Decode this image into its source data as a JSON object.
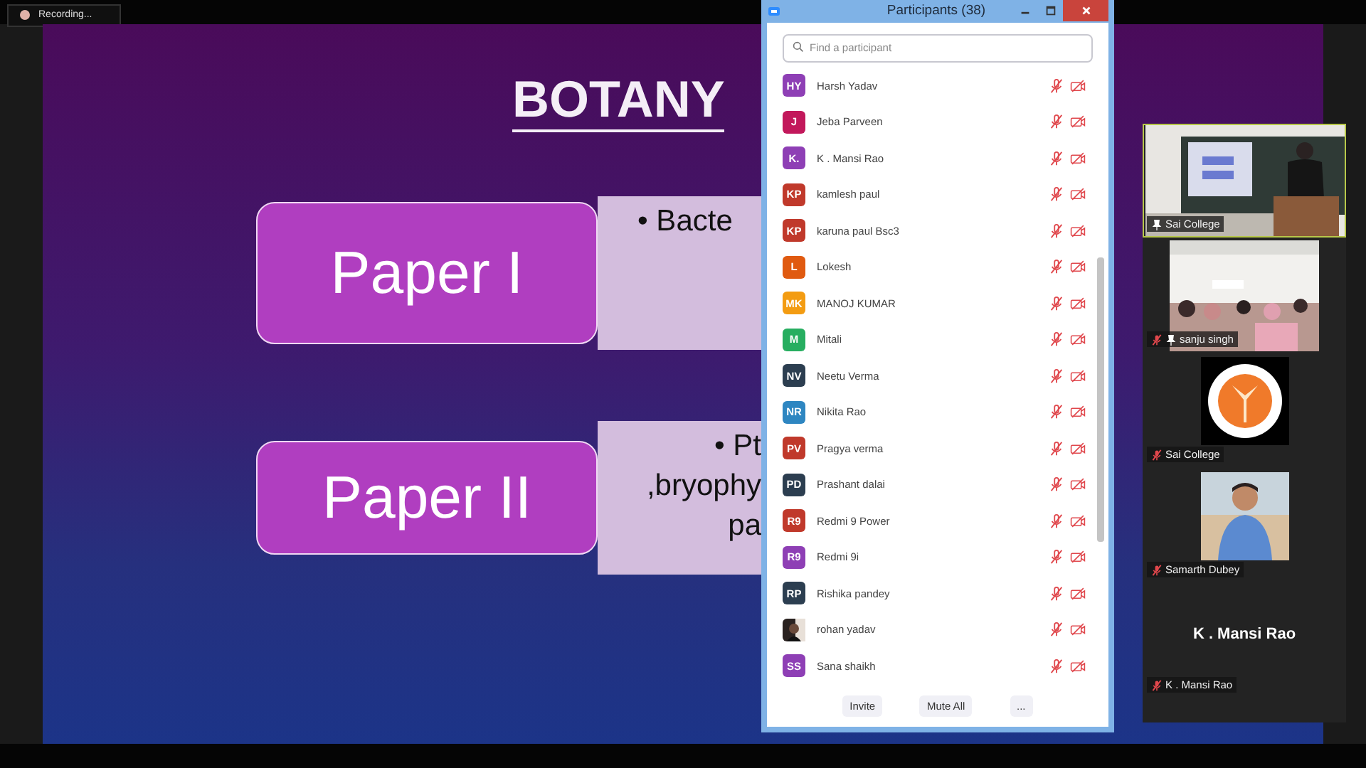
{
  "recording": {
    "label": "Recording..."
  },
  "slide": {
    "title": "BOTANY",
    "papers": [
      {
        "label": "Paper I",
        "lines": [
          "• Bacte"
        ]
      },
      {
        "label": "Paper II",
        "lines": [
          "• Pt",
          ",bryophy",
          "pa"
        ]
      }
    ]
  },
  "participants_window": {
    "title": "Participants (38)",
    "search": {
      "placeholder": "Find a participant"
    },
    "participants": [
      {
        "initials": "HY",
        "name": "Harsh Yadav",
        "color": "#8e3fb5",
        "kind": "initials",
        "muted": true,
        "video_off": true
      },
      {
        "initials": "J",
        "name": "Jeba Parveen",
        "color": "#c2185b",
        "kind": "initials",
        "muted": true,
        "video_off": true
      },
      {
        "initials": "K.",
        "name": "K . Mansi Rao",
        "color": "#8e3fb5",
        "kind": "initials",
        "muted": true,
        "video_off": true
      },
      {
        "initials": "KP",
        "name": "kamlesh paul",
        "color": "#c0392b",
        "kind": "initials",
        "muted": true,
        "video_off": true
      },
      {
        "initials": "KP",
        "name": "karuna paul Bsc3",
        "color": "#c0392b",
        "kind": "initials",
        "muted": true,
        "video_off": true
      },
      {
        "initials": "L",
        "name": "Lokesh",
        "color": "#e05a10",
        "kind": "initials",
        "muted": true,
        "video_off": true
      },
      {
        "initials": "MK",
        "name": "MANOJ KUMAR",
        "color": "#f39c12",
        "kind": "initials",
        "muted": true,
        "video_off": true
      },
      {
        "initials": "M",
        "name": "Mitali",
        "color": "#27ae60",
        "kind": "initials",
        "muted": true,
        "video_off": true
      },
      {
        "initials": "NV",
        "name": "Neetu Verma",
        "color": "#2c3e50",
        "kind": "initials",
        "muted": true,
        "video_off": true
      },
      {
        "initials": "NR",
        "name": "Nikita Rao",
        "color": "#2e86c1",
        "kind": "initials",
        "muted": true,
        "video_off": true
      },
      {
        "initials": "PV",
        "name": "Pragya verma",
        "color": "#c0392b",
        "kind": "initials",
        "muted": true,
        "video_off": true
      },
      {
        "initials": "PD",
        "name": "Prashant dalai",
        "color": "#2c3e50",
        "kind": "initials",
        "muted": true,
        "video_off": true
      },
      {
        "initials": "R9",
        "name": "Redmi 9 Power",
        "color": "#c0392b",
        "kind": "initials",
        "muted": true,
        "video_off": true
      },
      {
        "initials": "R9",
        "name": "Redmi 9i",
        "color": "#8e3fb5",
        "kind": "initials",
        "muted": true,
        "video_off": true
      },
      {
        "initials": "RP",
        "name": "Rishika pandey",
        "color": "#2c3e50",
        "kind": "initials",
        "muted": true,
        "video_off": true
      },
      {
        "name": "rohan yadav",
        "muted": true,
        "video_off": true
      },
      {
        "initials": "SS",
        "name": "Sana shaikh",
        "color": "#8e3fb5",
        "kind": "initials",
        "muted": true,
        "video_off": true
      }
    ],
    "buttons": [
      "Invite",
      "Mute All",
      "..."
    ]
  },
  "gallery": [
    {
      "name": "Sai College",
      "kind": "classroom",
      "pinned": true,
      "muted": false,
      "speaking": true
    },
    {
      "name": "sanju singh",
      "kind": "audience",
      "pinned": true,
      "muted": true,
      "speaking": false
    },
    {
      "name": "Sai College",
      "kind": "emblem",
      "pinned": false,
      "muted": true,
      "speaking": false
    },
    {
      "name": "Samarth Dubey",
      "kind": "portrait",
      "pinned": false,
      "muted": true,
      "speaking": false
    },
    {
      "name": "K . Mansi Rao",
      "kind": "name_only",
      "display_name": "K . Mansi Rao",
      "pinned": false,
      "muted": true,
      "speaking": false
    }
  ]
}
